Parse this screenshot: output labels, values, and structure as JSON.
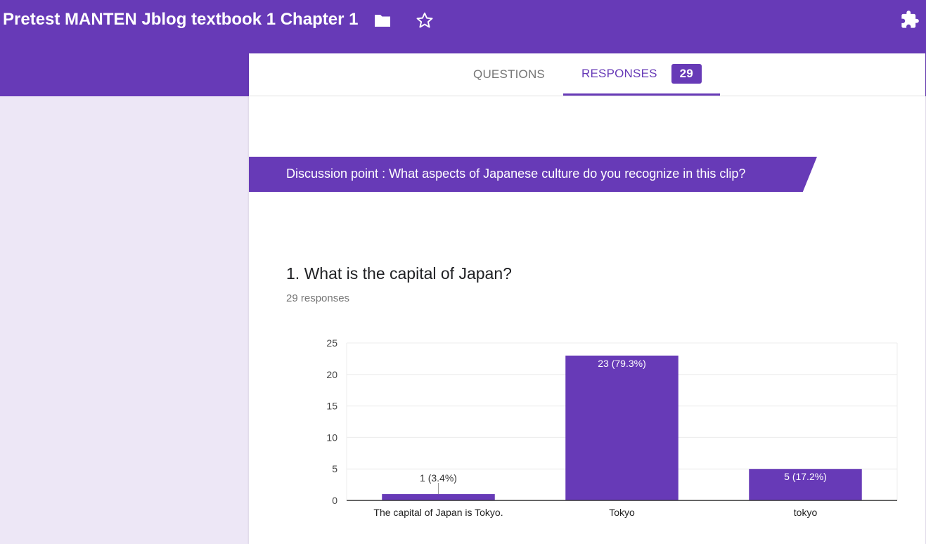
{
  "header": {
    "title": "Pretest MANTEN Jblog textbook 1 Chapter 1",
    "icons": [
      "folder-icon",
      "star-icon",
      "puzzle-icon"
    ]
  },
  "tabs": {
    "questions_label": "QUESTIONS",
    "responses_label": "RESPONSES",
    "responses_count": "29"
  },
  "section": {
    "title": "Discussion point : What aspects of Japanese culture do you recognize in this clip?"
  },
  "question": {
    "title": "1. What is the capital of Japan?",
    "responses": "29 responses"
  },
  "colors": {
    "accent": "#673ab7",
    "background": "#ede7f6"
  },
  "chart_data": {
    "type": "bar",
    "categories": [
      "The capital of Japan is Tokyo.",
      "Tokyo",
      "tokyo"
    ],
    "values": [
      1,
      23,
      5
    ],
    "data_labels": [
      "1 (3.4%)",
      "23 (79.3%)",
      "5 (17.2%)"
    ],
    "yticks": [
      "0",
      "5",
      "10",
      "15",
      "20",
      "25"
    ],
    "ylim": [
      0,
      25
    ],
    "grid": true
  }
}
